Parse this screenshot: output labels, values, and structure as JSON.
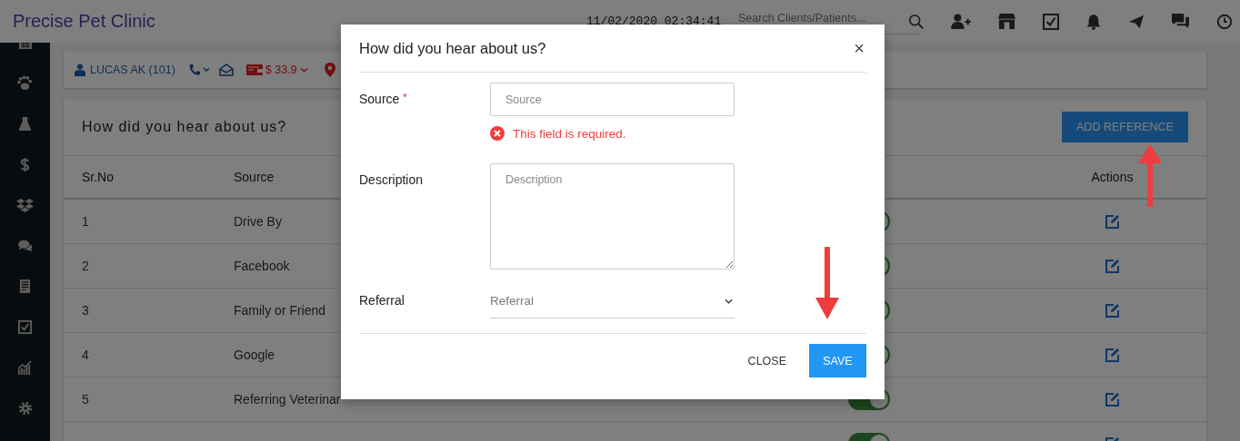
{
  "header": {
    "title": "Precise Pet Clinic",
    "datetime": "11/02/2020 02:34:41",
    "search": {
      "placeholder": "Search Clients/Patients..."
    }
  },
  "client_bar": {
    "client": "LUCAS AK (101)",
    "balance": "$ 33.9"
  },
  "panel": {
    "title": "How did you hear about us?",
    "add_button": "ADD REFERENCE",
    "columns": {
      "sr_no": "Sr.No",
      "source": "Source",
      "actions": "Actions"
    },
    "rows": [
      {
        "sr_no": "1",
        "source": "Drive By",
        "active": true
      },
      {
        "sr_no": "2",
        "source": "Facebook",
        "active": true
      },
      {
        "sr_no": "3",
        "source": "Family or Friend",
        "active": true
      },
      {
        "sr_no": "4",
        "source": "Google",
        "active": true
      },
      {
        "sr_no": "5",
        "source": "Referring Veterinar",
        "active": true
      },
      {
        "active": true
      }
    ]
  },
  "modal": {
    "title": "How did you hear about us?",
    "close_glyph": "×",
    "fields": [
      {
        "kind": "text",
        "label": "Source",
        "required_mark": "*",
        "placeholder": "Source",
        "error": "This field is required."
      },
      {
        "kind": "textarea",
        "label": "Description",
        "placeholder": "Description"
      },
      {
        "kind": "select",
        "label": "Referral",
        "placeholder": "Referral"
      }
    ],
    "buttons": {
      "close": "CLOSE",
      "save": "SAVE"
    }
  }
}
